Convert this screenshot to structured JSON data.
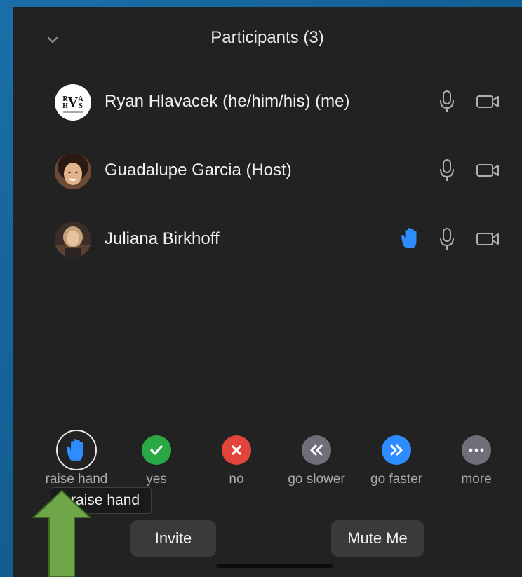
{
  "panel": {
    "title": "Participants (3)"
  },
  "participants": [
    {
      "name": "Ryan Hlavacek (he/him/his) (me)",
      "avatar_text": "RVHAS",
      "hand_raised": false
    },
    {
      "name": "Guadalupe Garcia (Host)",
      "hand_raised": false
    },
    {
      "name": "Juliana Birkhoff",
      "hand_raised": true
    }
  ],
  "reactions": [
    {
      "label": "raise hand",
      "icon": "raise-hand-icon"
    },
    {
      "label": "yes",
      "icon": "check-icon",
      "color": "#2aa846"
    },
    {
      "label": "no",
      "icon": "x-icon",
      "color": "#e0443a"
    },
    {
      "label": "go slower",
      "icon": "rewind-icon",
      "color": "#6f6f7a"
    },
    {
      "label": "go faster",
      "icon": "fast-forward-icon",
      "color": "#2d8cff"
    },
    {
      "label": "more",
      "icon": "more-icon",
      "color": "#6f6f7a"
    }
  ],
  "tooltip": "raise hand",
  "buttons": {
    "invite": "Invite",
    "mute": "Mute Me"
  },
  "colors": {
    "accent_blue": "#2d8cff",
    "panel_bg": "#222222",
    "arrow_green": "#6fa64a"
  }
}
